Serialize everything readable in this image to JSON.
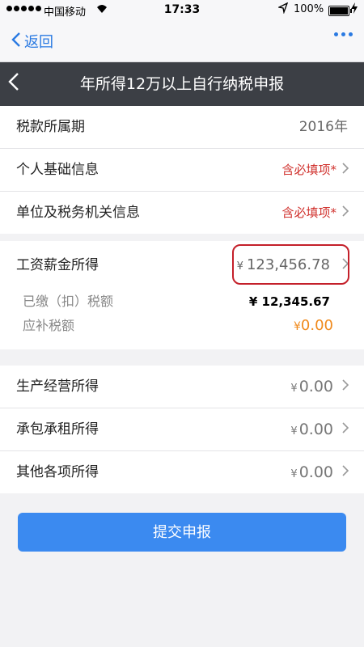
{
  "status_bar": {
    "carrier": "中国移动",
    "time": "17:33",
    "battery": "100%"
  },
  "nav": {
    "back_label": "返回"
  },
  "header": {
    "title": "年所得12万以上自行纳税申报"
  },
  "info_rows": [
    {
      "label": "税款所属期",
      "value": "2016年"
    },
    {
      "label": "个人基础信息",
      "value": "含必填项*"
    },
    {
      "label": "单位及税务机关信息",
      "value": "含必填项*"
    }
  ],
  "salary": {
    "label": "工资薪金所得",
    "currency": "¥",
    "amount": "123,456.78",
    "paid_label": "已缴（扣）税额",
    "paid_amount": "¥  12,345.67",
    "due_label": "应补税额",
    "due_currency": "¥",
    "due_amount": "0.00"
  },
  "income_rows": [
    {
      "label": "生产经营所得",
      "currency": "¥",
      "amount": "0.00"
    },
    {
      "label": "承包承租所得",
      "currency": "¥",
      "amount": "0.00"
    },
    {
      "label": "其他各项所得",
      "currency": "¥",
      "amount": "0.00"
    }
  ],
  "submit_label": "提交申报",
  "colors": {
    "accent": "#3b8af0",
    "header_bg": "#3c3f45",
    "required": "#d0312d",
    "due_amount": "#f08a1c",
    "highlight": "#c4202a"
  }
}
